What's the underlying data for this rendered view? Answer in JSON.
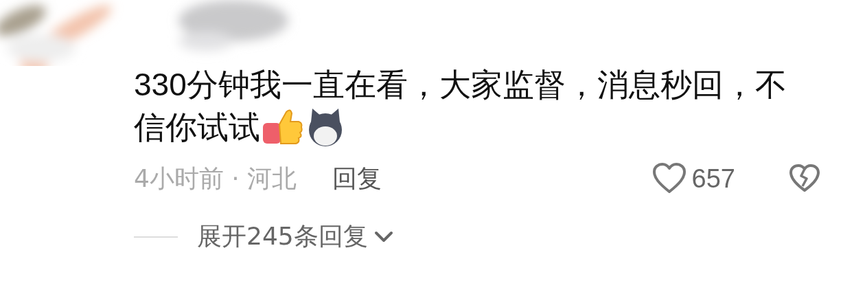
{
  "comment": {
    "text_lines": [
      "330分钟我一直在看，大家监督，消息秒回，不",
      "信你试试"
    ],
    "meta": "4小时前 · 河北",
    "reply_label": "回复",
    "likes": "657",
    "liked": false,
    "expand_label": "展开245条回复"
  }
}
